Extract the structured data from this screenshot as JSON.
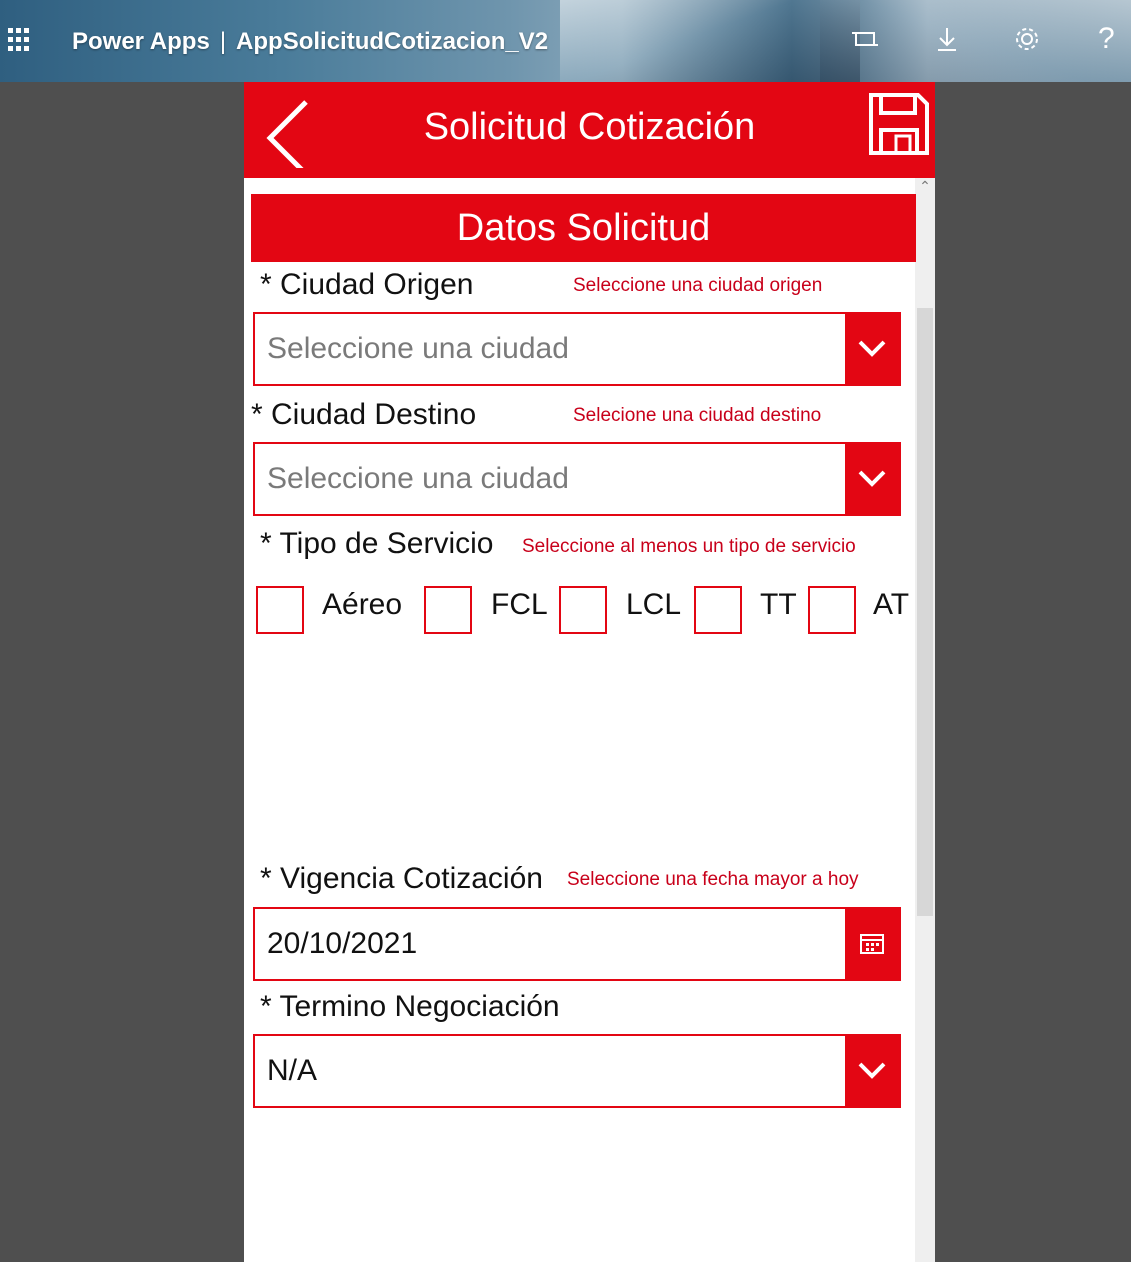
{
  "topbar": {
    "brand": "Power Apps",
    "separator": "|",
    "app_name": "AppSolicitudCotizacion_V2"
  },
  "header": {
    "title": "Solicitud Cotización"
  },
  "section": {
    "title": "Datos Solicitud"
  },
  "origin": {
    "label": "* Ciudad Origen",
    "error": "Seleccione una ciudad origen",
    "placeholder": "Seleccione una ciudad"
  },
  "destination": {
    "label": "* Ciudad Destino",
    "error": "Selecione una ciudad destino",
    "placeholder": "Seleccione una ciudad"
  },
  "service": {
    "label": "* Tipo de Servicio",
    "error": "Seleccione al menos un tipo de servicio",
    "options": [
      {
        "label": "Aéreo",
        "checked": false
      },
      {
        "label": "FCL",
        "checked": false
      },
      {
        "label": "LCL",
        "checked": false
      },
      {
        "label": "TT",
        "checked": false
      },
      {
        "label": "AT",
        "checked": false
      }
    ]
  },
  "validity": {
    "label": "* Vigencia Cotización",
    "error": "Seleccione una fecha mayor a hoy",
    "value": "20/10/2021"
  },
  "negotiation": {
    "label": "* Termino Negociación",
    "value": "N/A"
  },
  "colors": {
    "accent": "#e30613",
    "error_text": "#c8001a",
    "background": "#4f4f4f"
  }
}
